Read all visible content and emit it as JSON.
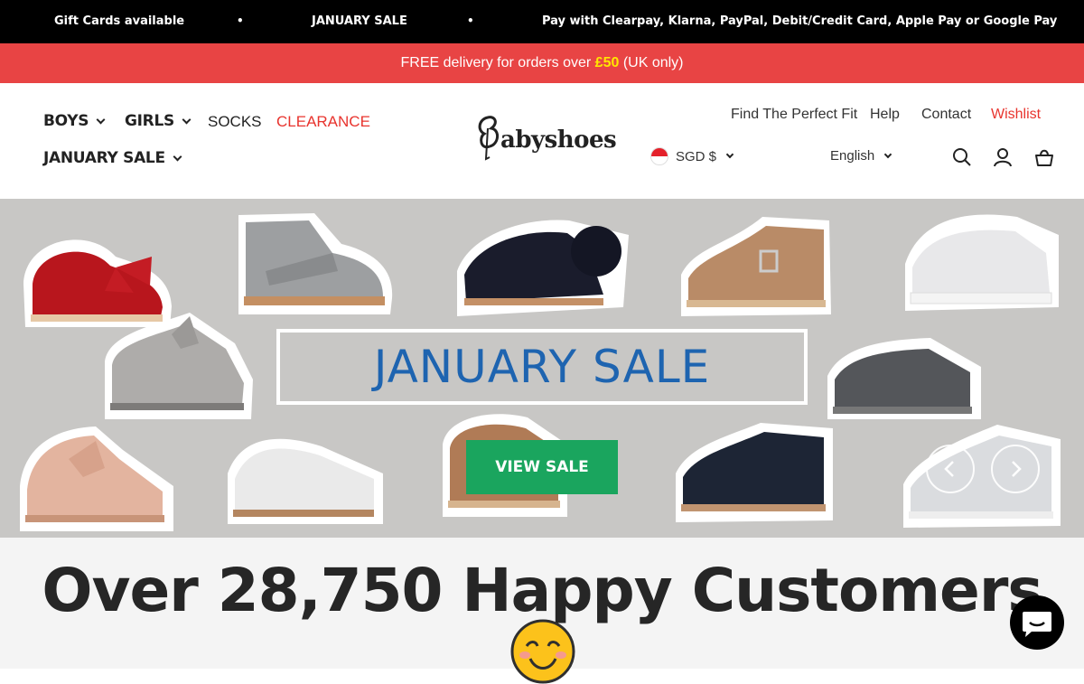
{
  "announcement": {
    "items": [
      "Gift Cards available",
      "JANUARY SALE",
      "Pay with Clearpay, Klarna, PayPal, Debit/Credit Card, Apple Pay or Google Pay"
    ],
    "separator": "•"
  },
  "promo": {
    "before": "FREE delivery for orders over ",
    "highlight": "£50",
    "after": " (UK only)",
    "bg_color": "#e84444",
    "highlight_color": "#ffe600"
  },
  "nav": {
    "boys": "BOYS",
    "girls": "GIRLS",
    "socks": "SOCKS",
    "clearance": "CLEARANCE",
    "january_sale": "JANUARY SALE"
  },
  "logo": {
    "text": "abyshoes",
    "initial": "B"
  },
  "utility": {
    "find_fit": "Find The Perfect Fit",
    "help": "Help",
    "contact": "Contact",
    "wishlist": "Wishlist",
    "currency": "SGD $",
    "language": "English"
  },
  "icons": {
    "search": "search-icon",
    "account": "account-icon",
    "cart": "cart-icon",
    "chat": "chat-icon"
  },
  "hero": {
    "title": "JANUARY SALE",
    "button": "VIEW SALE",
    "title_color": "#1e64b0",
    "button_color": "#1aa55e"
  },
  "customers": {
    "title": "Over 28,750 Happy Customers"
  }
}
